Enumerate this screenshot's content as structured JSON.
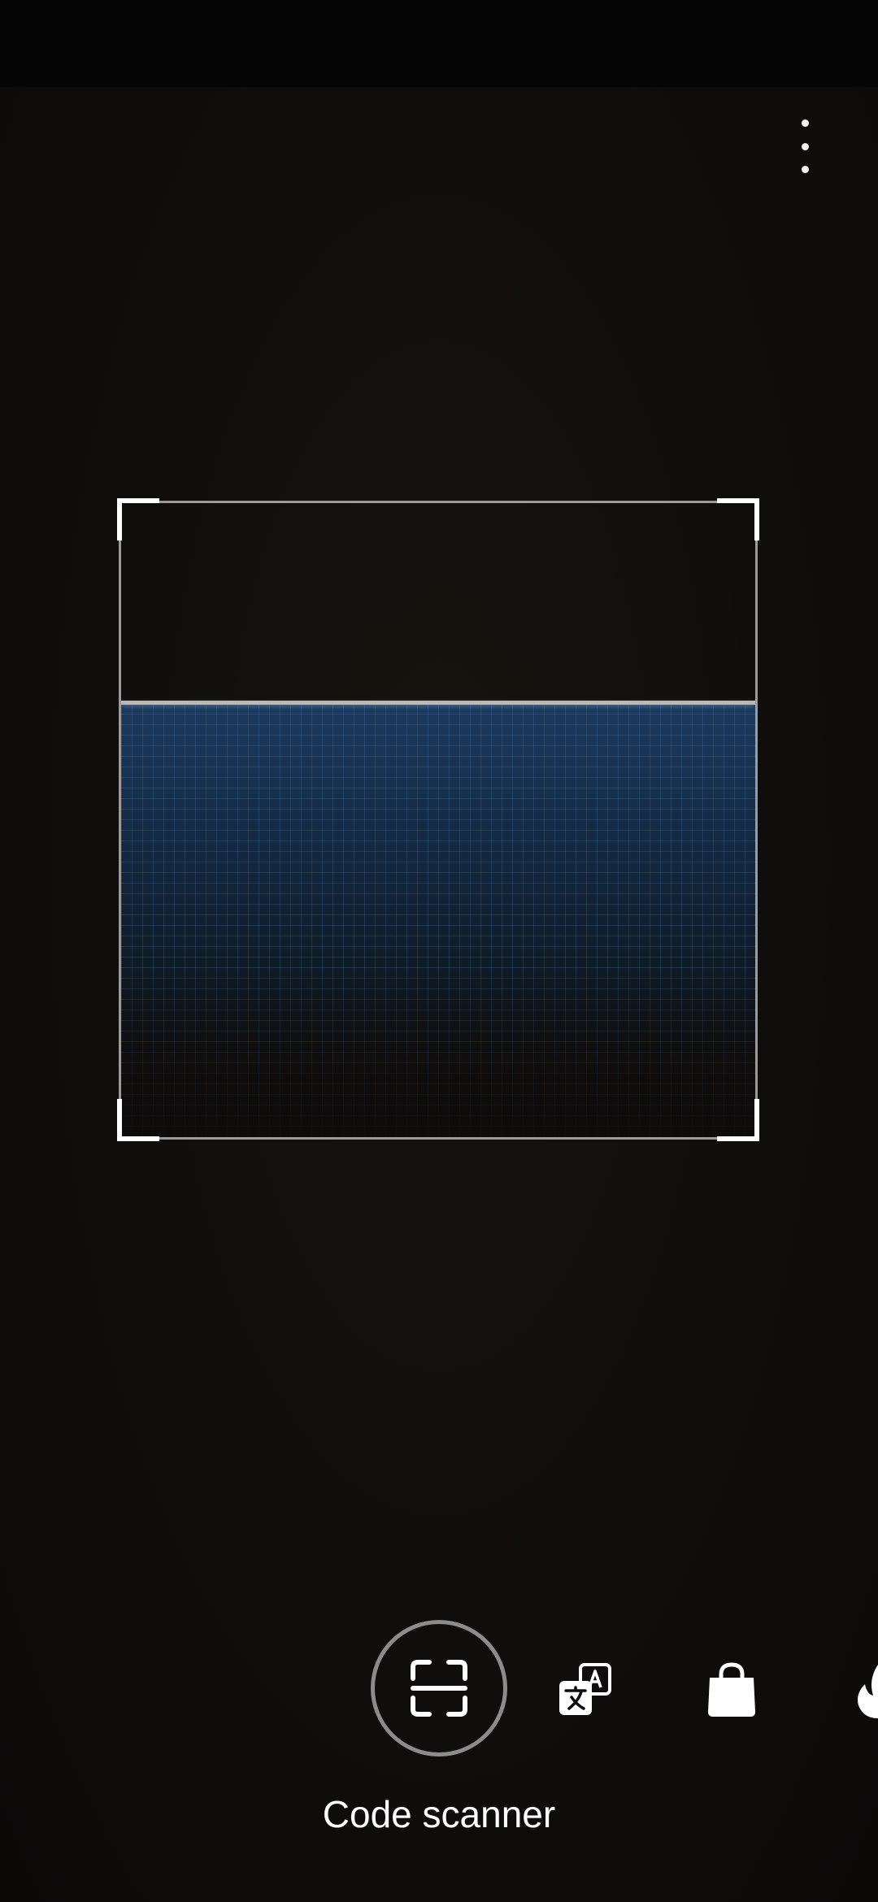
{
  "app": {
    "current_mode_label": "Code scanner"
  },
  "toolbar": {
    "overflow_icon": "more-vert-icon"
  },
  "modes": [
    {
      "id": "code-scanner",
      "icon": "code-scanner-icon",
      "selected": true
    },
    {
      "id": "translate",
      "icon": "translate-icon",
      "selected": false
    },
    {
      "id": "shopping",
      "icon": "shopping-bag-icon",
      "selected": false
    },
    {
      "id": "dining",
      "icon": "flame-icon",
      "selected": false
    }
  ],
  "colors": {
    "background": "#0e0c0b",
    "status_bar": "#050505",
    "viewfinder_frame": "#9b9b9b",
    "corner_marks": "#ffffff",
    "scan_tint": "#1c3a5e",
    "selected_ring": "#8c8c8c"
  }
}
